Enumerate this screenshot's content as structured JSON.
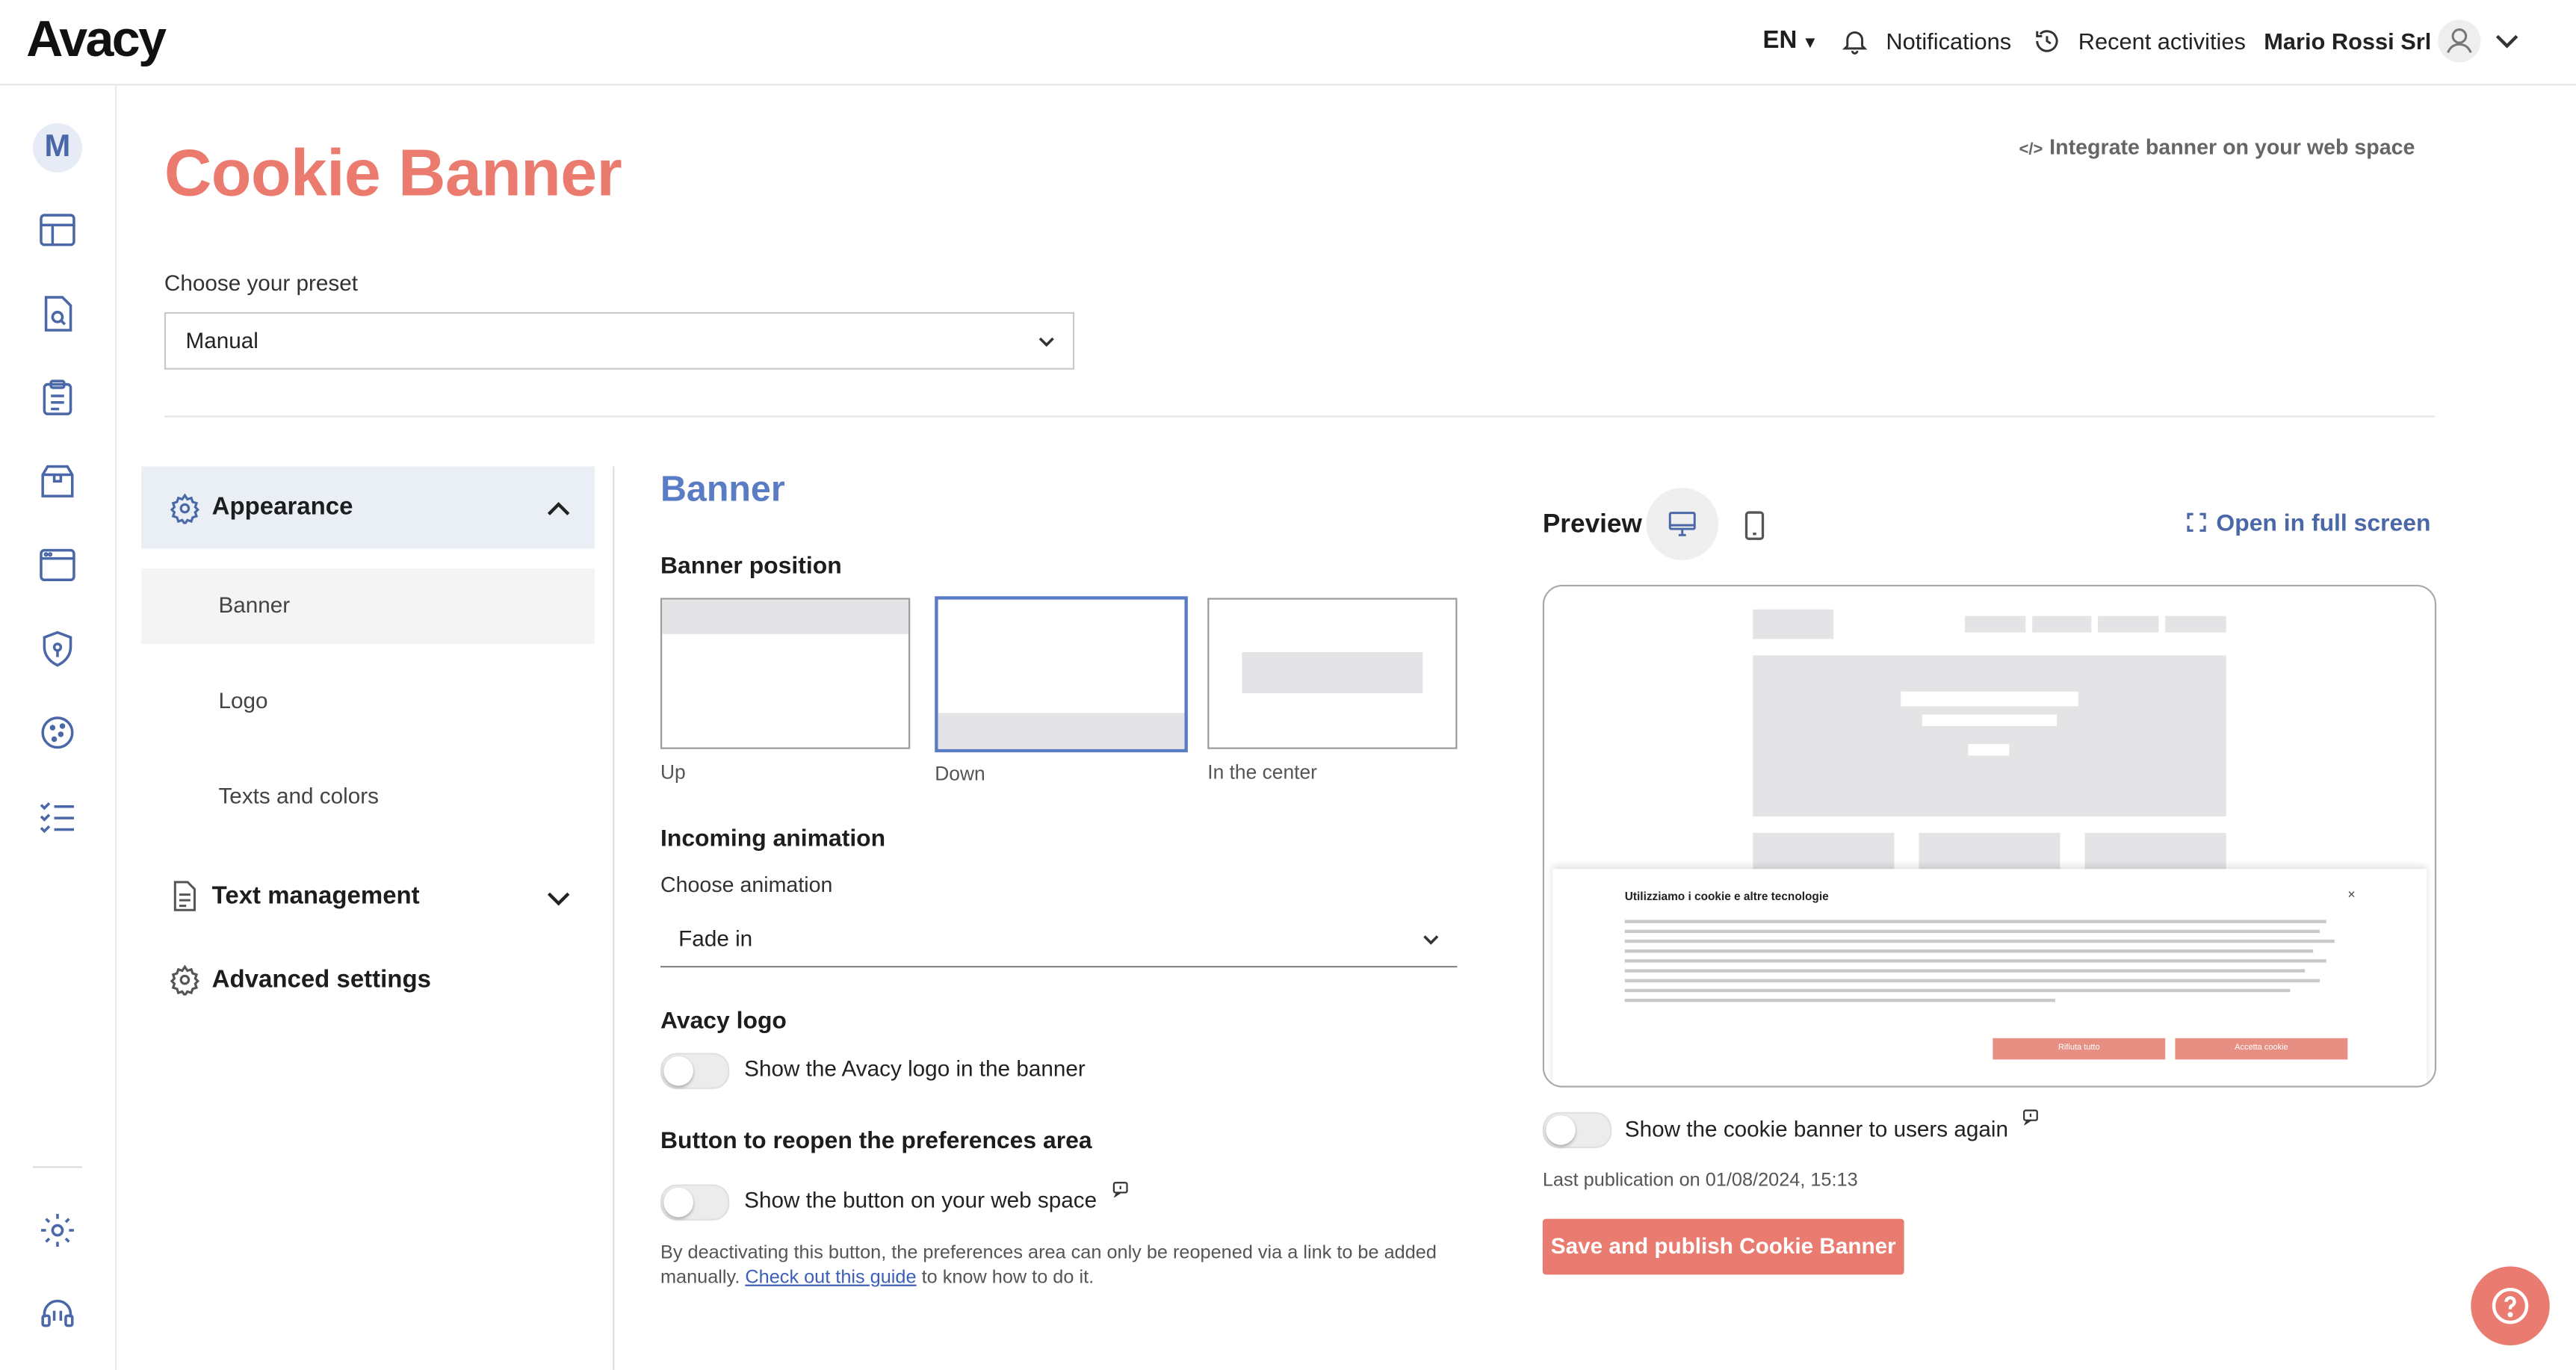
{
  "app": {
    "logo_text": "Avacy",
    "brand_color": "#ec7b6f",
    "accent_color": "#5a7cc4"
  },
  "topbar": {
    "language": "EN",
    "notifications_label": "Notifications",
    "recent_label": "Recent activities",
    "company_name": "Mario Rossi Srl"
  },
  "sidebar": {
    "avatar_initial": "M",
    "icons": [
      "dashboard-icon",
      "document-search-icon",
      "clipboard-icon",
      "package-icon",
      "browser-window-icon",
      "shield-icon",
      "cookie-icon",
      "checklist-icon",
      "settings-icon",
      "support-headset-icon"
    ]
  },
  "page": {
    "title": "Cookie Banner",
    "integrate_label": "Integrate banner on your web space",
    "preset_label": "Choose your preset",
    "preset_value": "Manual"
  },
  "menu": {
    "appearance": "Appearance",
    "items": [
      "Banner",
      "Logo",
      "Texts and colors"
    ],
    "text_management": "Text management",
    "advanced_settings": "Advanced settings"
  },
  "banner": {
    "heading": "Banner",
    "position_heading": "Banner position",
    "positions": [
      "Up",
      "Down",
      "In the center"
    ],
    "selected_position": "Down",
    "animation_heading": "Incoming animation",
    "animation_label": "Choose animation",
    "animation_value": "Fade in",
    "logo_heading": "Avacy logo",
    "logo_toggle_label": "Show the Avacy logo in the banner",
    "logo_toggle_on": false,
    "reopen_heading": "Button to reopen the preferences area",
    "reopen_toggle_label": "Show the button on your web space",
    "reopen_toggle_on": false,
    "note_text": "By deactivating this button, the preferences area can only be reopened via a link to be added manually.",
    "note_link": "Check out this guide",
    "note_suffix": "to know how to do it."
  },
  "preview": {
    "label": "Preview",
    "fullscreen_label": "Open in full screen",
    "banner_title": "Utilizziamo i cookie e altre tecnologie",
    "reject_label": "Rifiuta tutto",
    "accept_label": "Accetta cookie",
    "show_again_label": "Show the cookie banner to users again",
    "show_again_on": false,
    "last_publication": "Last publication on 01/08/2024, 15:13",
    "save_label": "Save and publish Cookie Banner"
  }
}
